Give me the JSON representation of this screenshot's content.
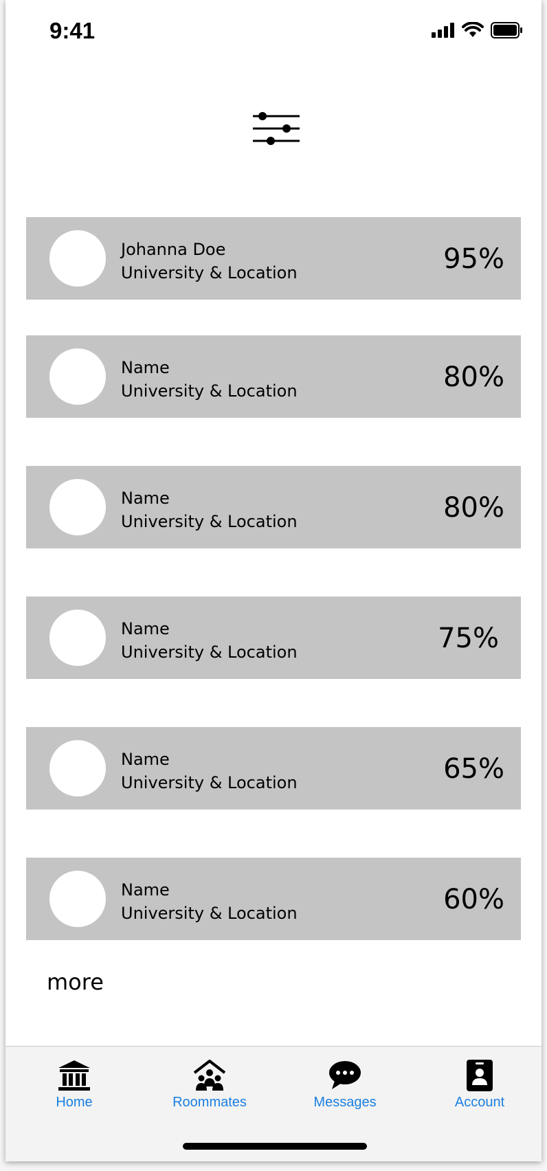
{
  "status_bar": {
    "time": "9:41"
  },
  "filter_button": {
    "icon": "sliders-icon"
  },
  "matches": [
    {
      "name": "Johanna Doe",
      "subtitle": "University & Location",
      "percent": "95%"
    },
    {
      "name": "Name",
      "subtitle": "University & Location",
      "percent": "80%"
    },
    {
      "name": "Name",
      "subtitle": "University & Location",
      "percent": "80%"
    },
    {
      "name": "Name",
      "subtitle": "University & Location",
      "percent": "75%"
    },
    {
      "name": "Name",
      "subtitle": "University & Location",
      "percent": "65%"
    },
    {
      "name": "Name",
      "subtitle": "University & Location",
      "percent": "60%"
    }
  ],
  "more_link": "more",
  "tab_bar": {
    "items": [
      {
        "label": "Home",
        "icon": "bank-icon"
      },
      {
        "label": "Roommates",
        "icon": "house-people-icon"
      },
      {
        "label": "Messages",
        "icon": "chat-bubble-icon"
      },
      {
        "label": "Account",
        "icon": "id-badge-icon"
      }
    ],
    "accent_color": "#1a7fe0"
  },
  "colors": {
    "card_background": "#c4c4c4",
    "avatar": "#ffffff",
    "tab_bar_background": "#f3f3f3"
  }
}
